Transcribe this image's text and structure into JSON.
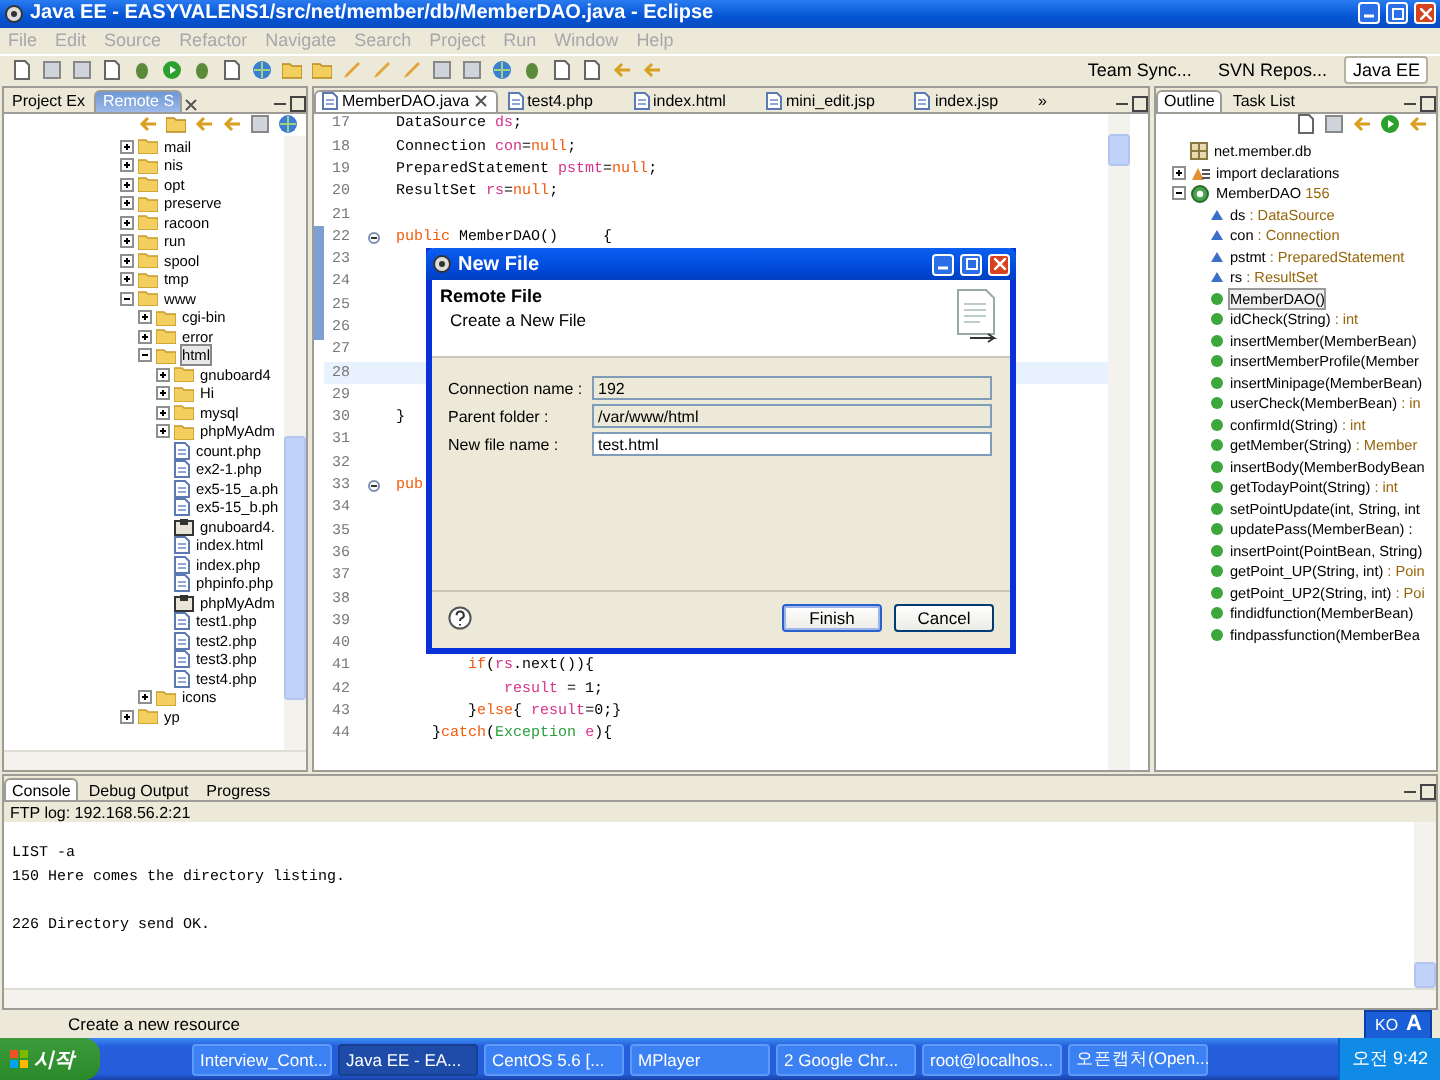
{
  "window": {
    "title": "Java EE - EASYVALENS1/src/net/member/db/MemberDAO.java - Eclipse"
  },
  "menu": [
    {
      "label": "File",
      "disabled": true
    },
    {
      "label": "Edit",
      "disabled": true
    },
    {
      "label": "Source",
      "disabled": true
    },
    {
      "label": "Refactor",
      "disabled": true
    },
    {
      "label": "Navigate",
      "disabled": true
    },
    {
      "label": "Search",
      "disabled": true
    },
    {
      "label": "Project",
      "disabled": true
    },
    {
      "label": "Run",
      "disabled": true
    },
    {
      "label": "Window",
      "disabled": true
    },
    {
      "label": "Help",
      "disabled": true
    }
  ],
  "perspectives": [
    {
      "label": "Team Sync...",
      "selected": false
    },
    {
      "label": "SVN Repos...",
      "selected": false
    },
    {
      "label": "Java EE",
      "selected": true
    }
  ],
  "left_panel": {
    "tabs": [
      {
        "label": "Project Ex",
        "selected": false
      },
      {
        "label": "Remote S",
        "selected": true
      }
    ],
    "tree": [
      {
        "label": "mail",
        "kind": "folder",
        "expanded": false,
        "selected": false
      },
      {
        "label": "nis",
        "kind": "folder",
        "expanded": false,
        "selected": false
      },
      {
        "label": "opt",
        "kind": "folder",
        "expanded": false,
        "selected": false
      },
      {
        "label": "preserve",
        "kind": "folder",
        "expanded": false,
        "selected": false
      },
      {
        "label": "racoon",
        "kind": "folder",
        "expanded": false,
        "selected": false
      },
      {
        "label": "run",
        "kind": "folder",
        "expanded": false,
        "selected": false
      },
      {
        "label": "spool",
        "kind": "folder",
        "expanded": false,
        "selected": false
      },
      {
        "label": "tmp",
        "kind": "folder",
        "expanded": false,
        "selected": false
      },
      {
        "label": "www",
        "kind": "folder",
        "expanded": true,
        "selected": false,
        "children": [
          {
            "label": "cgi-bin",
            "kind": "folder",
            "expanded": false,
            "selected": false
          },
          {
            "label": "error",
            "kind": "folder",
            "expanded": false,
            "selected": false
          },
          {
            "label": "html",
            "kind": "folder",
            "expanded": true,
            "selected": true,
            "children": [
              {
                "label": "gnuboard4",
                "kind": "folder",
                "expanded": false,
                "selected": false
              },
              {
                "label": "Hi",
                "kind": "folder",
                "expanded": false,
                "selected": false
              },
              {
                "label": "mysql",
                "kind": "folder",
                "expanded": false,
                "selected": false
              },
              {
                "label": "phpMyAdm",
                "kind": "folder",
                "expanded": false,
                "selected": false
              },
              {
                "label": "count.php",
                "kind": "file",
                "selected": false
              },
              {
                "label": "ex2-1.php",
                "kind": "file",
                "selected": false
              },
              {
                "label": "ex5-15_a.ph",
                "kind": "file",
                "selected": false
              },
              {
                "label": "ex5-15_b.ph",
                "kind": "file",
                "selected": false
              },
              {
                "label": "gnuboard4.",
                "kind": "archive",
                "selected": false
              },
              {
                "label": "index.html",
                "kind": "file",
                "selected": false
              },
              {
                "label": "index.php",
                "kind": "file",
                "selected": false
              },
              {
                "label": "phpinfo.php",
                "kind": "file",
                "selected": false
              },
              {
                "label": "phpMyAdm",
                "kind": "archive",
                "selected": false
              },
              {
                "label": "test1.php",
                "kind": "file",
                "selected": false
              },
              {
                "label": "test2.php",
                "kind": "file",
                "selected": false
              },
              {
                "label": "test3.php",
                "kind": "file",
                "selected": false
              },
              {
                "label": "test4.php",
                "kind": "file",
                "selected": false
              }
            ]
          },
          {
            "label": "icons",
            "kind": "folder",
            "expanded": false,
            "selected": false
          }
        ]
      },
      {
        "label": "yp",
        "kind": "folder",
        "expanded": false,
        "selected": false
      }
    ]
  },
  "editor": {
    "tabs": [
      {
        "label": "MemberDAO.java",
        "selected": true
      },
      {
        "label": "test4.php",
        "selected": false
      },
      {
        "label": "index.html",
        "selected": false
      },
      {
        "label": "mini_edit.jsp",
        "selected": false
      },
      {
        "label": "index.jsp",
        "selected": false
      }
    ],
    "overflow": "»",
    "lines": [
      {
        "number": "17",
        "code": [
          {
            "text": "DataSource ",
            "kind": "plain"
          },
          {
            "text": "ds",
            "kind": "field"
          },
          {
            "text": ";",
            "kind": "plain"
          }
        ]
      },
      {
        "number": "18",
        "code": [
          {
            "text": "Connection ",
            "kind": "plain"
          },
          {
            "text": "con",
            "kind": "field"
          },
          {
            "text": "=",
            "kind": "plain"
          },
          {
            "text": "null",
            "kind": "keyword"
          },
          {
            "text": ";",
            "kind": "plain"
          }
        ]
      },
      {
        "number": "19",
        "code": [
          {
            "text": "PreparedStatement ",
            "kind": "plain"
          },
          {
            "text": "pstmt",
            "kind": "field"
          },
          {
            "text": "=",
            "kind": "plain"
          },
          {
            "text": "null",
            "kind": "keyword"
          },
          {
            "text": ";",
            "kind": "plain"
          }
        ]
      },
      {
        "number": "20",
        "code": [
          {
            "text": "ResultSet ",
            "kind": "plain"
          },
          {
            "text": "rs",
            "kind": "field"
          },
          {
            "text": "=",
            "kind": "plain"
          },
          {
            "text": "null",
            "kind": "keyword"
          },
          {
            "text": ";",
            "kind": "plain"
          }
        ]
      },
      {
        "number": "21"
      },
      {
        "number": "22",
        "foldable": true,
        "code": [
          {
            "text": "public",
            "kind": "keyword"
          },
          {
            "text": " MemberDAO()     {",
            "kind": "plain"
          }
        ]
      },
      {
        "number": "23"
      },
      {
        "number": "24"
      },
      {
        "number": "25"
      },
      {
        "number": "26"
      },
      {
        "number": "27"
      },
      {
        "number": "28",
        "current": true
      },
      {
        "number": "29"
      },
      {
        "number": "30",
        "code": [
          {
            "text": "}",
            "kind": "plain"
          }
        ]
      },
      {
        "number": "31"
      },
      {
        "number": "32"
      },
      {
        "number": "33",
        "foldable": true,
        "code": [
          {
            "text": "pub",
            "kind": "keyword"
          }
        ]
      },
      {
        "number": "34"
      },
      {
        "number": "35"
      },
      {
        "number": "36"
      },
      {
        "number": "37"
      },
      {
        "number": "38"
      },
      {
        "number": "39"
      },
      {
        "number": "40"
      },
      {
        "number": "41",
        "code": [
          {
            "text": "        if",
            "kind": "keyword"
          },
          {
            "text": "(",
            "kind": "plain"
          },
          {
            "text": "rs",
            "kind": "field"
          },
          {
            "text": ".next()){",
            "kind": "plain"
          }
        ]
      },
      {
        "number": "42",
        "code": [
          {
            "text": "            result",
            "kind": "field"
          },
          {
            "text": " = 1;",
            "kind": "plain"
          }
        ]
      },
      {
        "number": "43",
        "code": [
          {
            "text": "        }",
            "kind": "plain"
          },
          {
            "text": "else",
            "kind": "keyword"
          },
          {
            "text": "{ ",
            "kind": "plain"
          },
          {
            "text": "result",
            "kind": "field"
          },
          {
            "text": "=0;}",
            "kind": "plain"
          }
        ]
      },
      {
        "number": "44",
        "code": [
          {
            "text": "    }",
            "kind": "plain"
          },
          {
            "text": "catch",
            "kind": "keyword"
          },
          {
            "text": "(",
            "kind": "plain"
          },
          {
            "text": "Exception",
            "kind": "type"
          },
          {
            "text": " e",
            "kind": "field"
          },
          {
            "text": "){",
            "kind": "plain"
          }
        ]
      }
    ]
  },
  "outline": {
    "tabs": [
      {
        "label": "Outline",
        "selected": true
      },
      {
        "label": "Task List",
        "selected": false
      }
    ],
    "items": [
      {
        "name": "net.member.db",
        "kind": "package",
        "selected": false
      },
      {
        "name": "import declarations",
        "kind": "imports",
        "expanded": false,
        "selected": false
      },
      {
        "name": "MemberDAO",
        "type": " 156",
        "kind": "class",
        "expanded": true,
        "selected": false,
        "children": [
          {
            "name": "ds",
            "type": " : DataSource",
            "kind": "field",
            "selected": false
          },
          {
            "name": "con",
            "type": " : Connection",
            "kind": "field",
            "selected": false
          },
          {
            "name": "pstmt",
            "type": " : PreparedStatement",
            "kind": "field",
            "selected": false
          },
          {
            "name": "rs",
            "type": " : ResultSet",
            "kind": "field",
            "selected": false
          },
          {
            "name": "MemberDAO()",
            "kind": "constructor",
            "selected": true
          },
          {
            "name": "idCheck(String)",
            "type": " : int",
            "kind": "method",
            "selected": false
          },
          {
            "name": "insertMember(MemberBean)",
            "kind": "method",
            "selected": false
          },
          {
            "name": "insertMemberProfile(Member",
            "kind": "method",
            "selected": false
          },
          {
            "name": "insertMinipage(MemberBean)",
            "kind": "method",
            "selected": false
          },
          {
            "name": "userCheck(MemberBean)",
            "type": " : in",
            "kind": "method",
            "selected": false
          },
          {
            "name": "confirmId(String)",
            "type": " : int",
            "kind": "method",
            "selected": false
          },
          {
            "name": "getMember(String)",
            "type": " : Member",
            "kind": "method",
            "selected": false
          },
          {
            "name": "insertBody(MemberBodyBean",
            "kind": "method",
            "selected": false
          },
          {
            "name": "getTodayPoint(String)",
            "type": " : int",
            "kind": "method",
            "selected": false
          },
          {
            "name": "setPointUpdate(int, String, int",
            "kind": "method",
            "selected": false
          },
          {
            "name": "updatePass(MemberBean) :",
            "kind": "method",
            "selected": false
          },
          {
            "name": "insertPoint(PointBean, String)",
            "kind": "method",
            "selected": false
          },
          {
            "name": "getPoint_UP(String, int)",
            "type": " : Poin",
            "kind": "method",
            "selected": false
          },
          {
            "name": "getPoint_UP2(String, int)",
            "type": " : Poi",
            "kind": "method",
            "selected": false
          },
          {
            "name": "findidfunction(MemberBean)",
            "kind": "method",
            "selected": false
          },
          {
            "name": "findpassfunction(MemberBea",
            "kind": "method",
            "selected": false
          }
        ]
      }
    ]
  },
  "console": {
    "tabs": [
      {
        "label": "Console",
        "selected": true
      },
      {
        "label": "Debug Output",
        "selected": false
      },
      {
        "label": "Progress",
        "selected": false
      }
    ],
    "log_label": "FTP log: 192.168.56.2:21",
    "blocks": [
      [
        "LIST -a",
        "150 Here comes the directory listing."
      ],
      [
        "226 Directory send OK."
      ]
    ]
  },
  "status_bar": {
    "message": "Create a new resource",
    "ime": "KO",
    "ime_mode": "A"
  },
  "dialog": {
    "title": "New File",
    "heading": "Remote File",
    "description": "Create a New File",
    "fields": [
      {
        "label": "Connection name :",
        "value": "192",
        "disabled": true
      },
      {
        "label": "Parent folder :",
        "value": "/var/www/html",
        "disabled": true
      },
      {
        "label": "New file name :",
        "value": "test.html",
        "disabled": false
      }
    ],
    "buttons": [
      {
        "label": "Finish",
        "default": true
      },
      {
        "label": "Cancel",
        "default": false
      }
    ]
  },
  "taskbar": {
    "start": "시작",
    "items": [
      {
        "label": "Interview_Cont...",
        "selected": false
      },
      {
        "label": "Java EE - EA...",
        "selected": true
      },
      {
        "label": "CentOS 5.6 [...",
        "selected": false
      },
      {
        "label": "MPlayer",
        "selected": false
      },
      {
        "label": "2 Google Chr...",
        "selected": false
      },
      {
        "label": "root@localhos...",
        "selected": false
      },
      {
        "label": "오픈캡처(Open...",
        "selected": false
      }
    ],
    "clock": "오전 9:42"
  }
}
